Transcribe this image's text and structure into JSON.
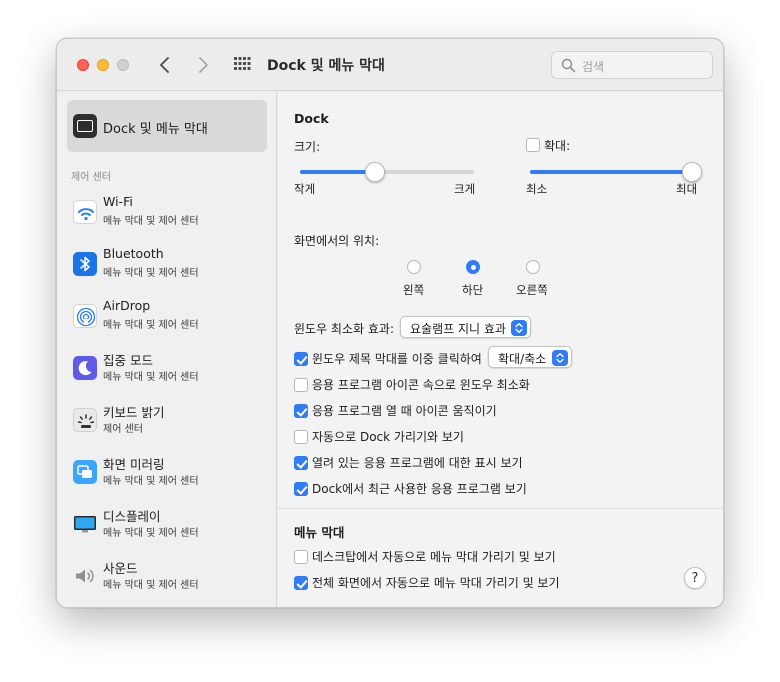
{
  "window": {
    "title": "Dock 및 메뉴 막대",
    "search_placeholder": "검색"
  },
  "sidebar": {
    "selected_label": "Dock 및 메뉴 막대",
    "section_label": "제어 센터",
    "items": [
      {
        "title": "Wi-Fi",
        "subtitle": "메뉴 막대 및 제어 센터"
      },
      {
        "title": "Bluetooth",
        "subtitle": "메뉴 막대 및 제어 센터"
      },
      {
        "title": "AirDrop",
        "subtitle": "메뉴 막대 및 제어 센터"
      },
      {
        "title": "집중 모드",
        "subtitle": "메뉴 막대 및 제어 센터"
      },
      {
        "title": "키보드 밝기",
        "subtitle": "제어 센터"
      },
      {
        "title": "화면 미러링",
        "subtitle": "메뉴 막대 및 제어 센터"
      },
      {
        "title": "디스플레이",
        "subtitle": "메뉴 막대 및 제어 센터"
      },
      {
        "title": "사운드",
        "subtitle": "메뉴 막대 및 제어 센터"
      }
    ]
  },
  "dock": {
    "section_title": "Dock",
    "size": {
      "label": "크기:",
      "min_label": "작게",
      "max_label": "크게",
      "value_fraction": 0.43
    },
    "magnification": {
      "label": "확대:",
      "checked": false,
      "min_label": "최소",
      "max_label": "최대",
      "value_fraction": 1.0
    },
    "position": {
      "label": "화면에서의 위치:",
      "options": [
        {
          "label": "왼쪽",
          "selected": false
        },
        {
          "label": "하단",
          "selected": true
        },
        {
          "label": "오른쪽",
          "selected": false
        }
      ]
    },
    "minimize_effect": {
      "label": "윈도우 최소화 효과:",
      "value": "요술램프 지니 효과"
    },
    "checkboxes": [
      {
        "label": "윈도우 제목 막대를 이중 클릭하여",
        "checked": true,
        "popup_value": "확대/축소"
      },
      {
        "label": "응용 프로그램 아이콘 속으로 윈도우 최소화",
        "checked": false
      },
      {
        "label": "응용 프로그램 열 때 아이콘 움직이기",
        "checked": true
      },
      {
        "label": "자동으로 Dock 가리기와 보기",
        "checked": false
      },
      {
        "label": "열려 있는 응용 프로그램에 대한 표시 보기",
        "checked": true
      },
      {
        "label": "Dock에서 최근 사용한 응용 프로그램 보기",
        "checked": true
      }
    ]
  },
  "menubar": {
    "section_title": "메뉴 막대",
    "checkboxes": [
      {
        "label": "데스크탑에서 자동으로 메뉴 막대 가리기 및 보기",
        "checked": false
      },
      {
        "label": "전체 화면에서 자동으로 메뉴 막대 가리기 및 보기",
        "checked": true
      }
    ],
    "help_label": "?"
  },
  "colors": {
    "accent": "#2f7cf6",
    "focus_icon": "#5e5ce6",
    "bluetooth_icon": "#1a73e8"
  }
}
